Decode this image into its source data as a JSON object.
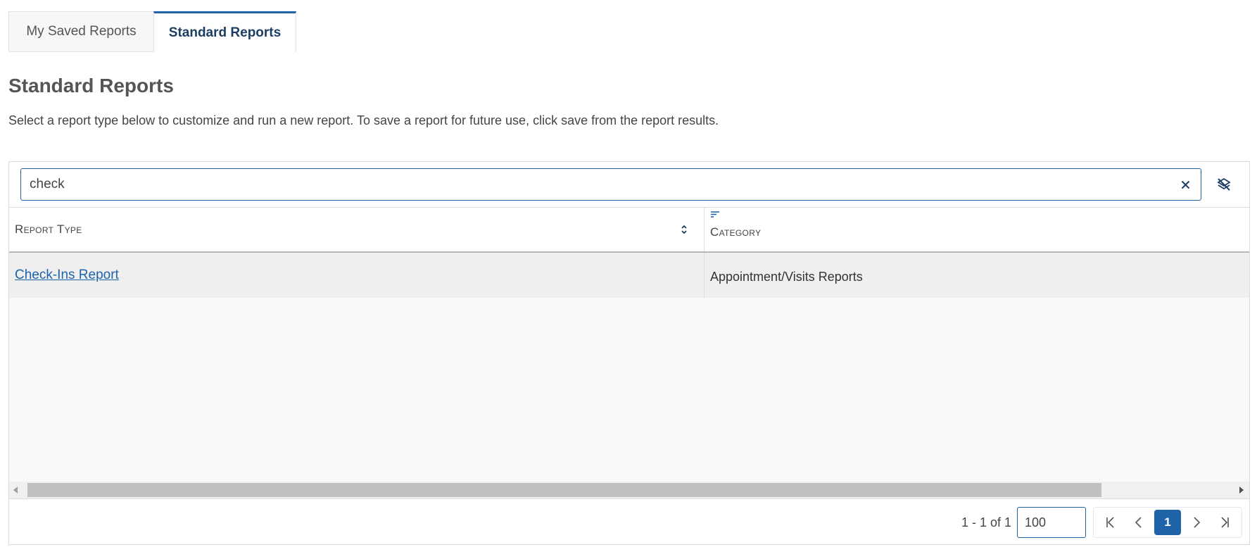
{
  "tabs": [
    {
      "label": "My Saved Reports",
      "active": false
    },
    {
      "label": "Standard Reports",
      "active": true
    }
  ],
  "page": {
    "title": "Standard Reports",
    "description": "Select a report type below to customize and run a new report. To save a report for future use, click save from the report results."
  },
  "search": {
    "value": "check",
    "clear_icon": "close-icon",
    "column_toggle_icon": "layers-off-icon"
  },
  "grid": {
    "columns": [
      {
        "label": "Report Type",
        "icon": "sort-icon"
      },
      {
        "label": "Category",
        "icon": "filter-lines-icon"
      }
    ],
    "rows": [
      {
        "report_type": "Check-Ins Report",
        "category": "Appointment/Visits Reports"
      }
    ]
  },
  "pager": {
    "info": "1 - 1 of 1",
    "page_size": "100",
    "current_page": "1",
    "first_icon": "first-page-icon",
    "prev_icon": "chevron-left-icon",
    "next_icon": "chevron-right-icon",
    "last_icon": "last-page-icon"
  },
  "colors": {
    "accent": "#1e63a8",
    "active_tab_text": "#1d3e63",
    "row_bg": "#efefef"
  }
}
